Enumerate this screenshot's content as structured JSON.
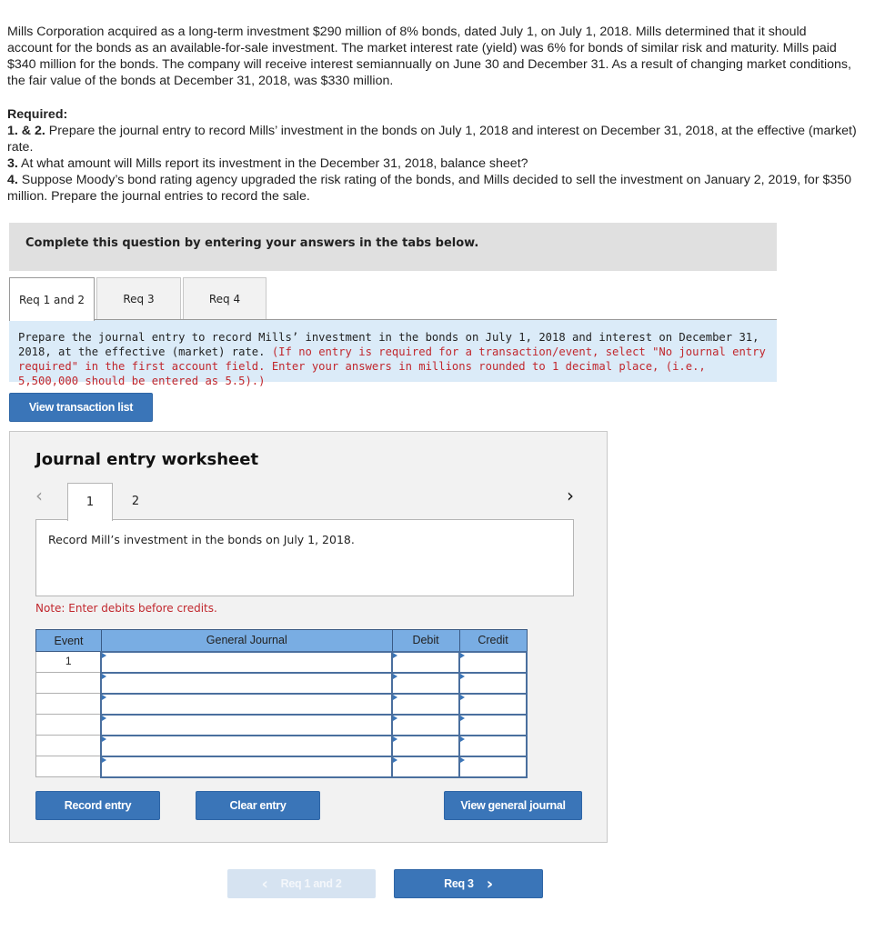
{
  "problem": {
    "text": "Mills Corporation acquired as a long-term investment $290 million of 8% bonds, dated July 1, on July 1, 2018. Mills determined that it should account for the bonds as an available-for-sale investment. The market interest rate (yield) was 6% for bonds of similar risk and maturity. Mills paid $340 million for the bonds. The company will receive interest semiannually on June 30 and December 31. As a result of changing market conditions, the fair value of the bonds at December 31, 2018, was $330 million."
  },
  "required": {
    "heading": "Required:",
    "items": [
      {
        "num": "1. & 2.",
        "text": " Prepare the journal entry to record Mills’ investment in the bonds on July 1, 2018 and interest on December 31, 2018, at the effective (market) rate."
      },
      {
        "num": "3.",
        "text": " At what amount will Mills report its investment in the December 31, 2018, balance sheet?"
      },
      {
        "num": "4.",
        "text": " Suppose Moody’s bond rating agency upgraded the risk rating of the bonds, and Mills decided to sell the investment on January 2, 2019, for $350 million. Prepare the journal entries to record the sale."
      }
    ]
  },
  "banner": {
    "text": "Complete this question by entering your answers in the tabs below."
  },
  "tabs": [
    {
      "label": "Req 1 and 2",
      "active": true
    },
    {
      "label": "Req 3",
      "active": false
    },
    {
      "label": "Req 4",
      "active": false
    }
  ],
  "instructions": {
    "main": "Prepare the journal entry to record Mills’ investment in the bonds on July 1, 2018 and interest on December 31, 2018, at the effective (market) rate.",
    "note": "(If no entry is required for a transaction/event, select \"No journal entry required\" in the first account field. Enter your answers in millions rounded to 1 decimal place, (i.e., 5,500,000 should be entered as 5.5).)"
  },
  "view_transaction_list_label": "View transaction list",
  "worksheet": {
    "title": "Journal entry worksheet",
    "prev_icon": "‹",
    "next_icon": "›",
    "entry_tabs": [
      "1",
      "2"
    ],
    "active_entry": "1",
    "description": "Record Mill’s investment in the bonds on July 1, 2018.",
    "note": "Note: Enter debits before credits.",
    "table": {
      "headers": [
        "Event",
        "General Journal",
        "Debit",
        "Credit"
      ],
      "rows": [
        {
          "event": "1",
          "account": "",
          "debit": "",
          "credit": ""
        },
        {
          "event": "",
          "account": "",
          "debit": "",
          "credit": ""
        },
        {
          "event": "",
          "account": "",
          "debit": "",
          "credit": ""
        },
        {
          "event": "",
          "account": "",
          "debit": "",
          "credit": ""
        },
        {
          "event": "",
          "account": "",
          "debit": "",
          "credit": ""
        },
        {
          "event": "",
          "account": "",
          "debit": "",
          "credit": ""
        }
      ]
    },
    "buttons": {
      "record": "Record entry",
      "clear": "Clear entry",
      "view_journal": "View general journal"
    }
  },
  "nav": {
    "prev_label": "Req 1 and 2",
    "prev_icon": "‹",
    "next_label": "Req 3",
    "next_icon": "›"
  }
}
